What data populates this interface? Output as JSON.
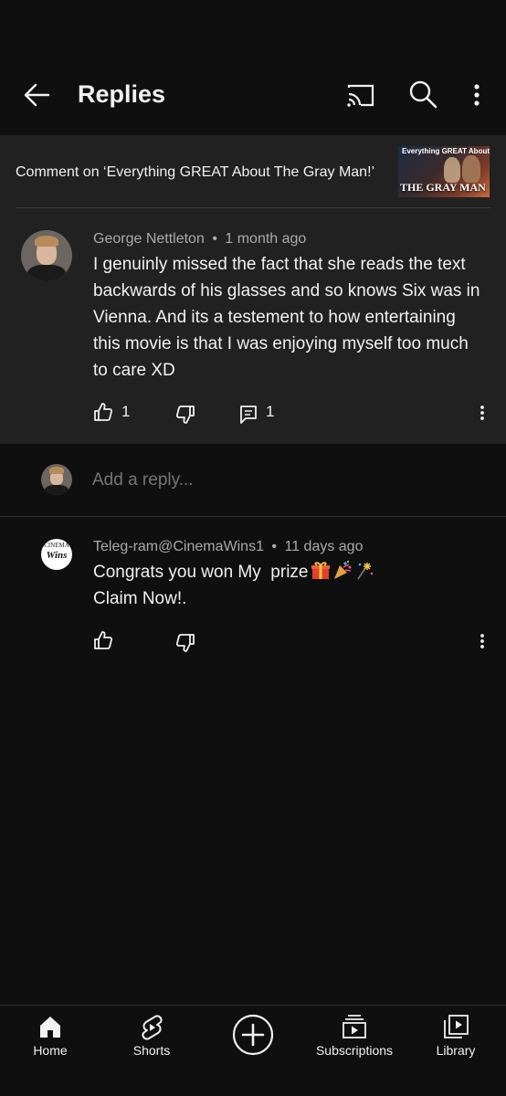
{
  "header": {
    "title": "Replies"
  },
  "context": {
    "text": "Comment on ‘Everything GREAT About The Gray Man!’",
    "thumb_top": "Everything GREAT About",
    "thumb_main": "THE GRAY MAN"
  },
  "main_comment": {
    "author": "George Nettleton",
    "separator": "•",
    "time": "1 month ago",
    "text": "I genuinly missed the fact that she reads the text backwards of his glasses and so knows Six was in Vienna. And its a testement to how entertaining this movie is that I was enjoying myself too much to care XD",
    "likes": "1",
    "replies": "1"
  },
  "reply_box": {
    "placeholder": "Add a reply..."
  },
  "reply": {
    "author": "Teleg-ram@CinemaWins1",
    "separator": "•",
    "time": "11 days ago",
    "line1": "Congrats you won My  prize",
    "line2": "Claim Now!.",
    "avatar_small": "CINEMA",
    "avatar_big": "Wins",
    "emojis": [
      "gift-icon",
      "party-popper-icon",
      "sparkler-icon"
    ]
  },
  "nav": {
    "items": [
      {
        "label": "Home",
        "icon": "home-icon"
      },
      {
        "label": "Shorts",
        "icon": "shorts-icon"
      },
      {
        "label": "",
        "icon": "create-icon"
      },
      {
        "label": "Subscriptions",
        "icon": "subscriptions-icon"
      },
      {
        "label": "Library",
        "icon": "library-icon"
      }
    ]
  },
  "colors": {
    "background": "#0f0f0f",
    "panel": "#212121",
    "text": "#f1f1f1",
    "muted": "#aaaaaa"
  }
}
